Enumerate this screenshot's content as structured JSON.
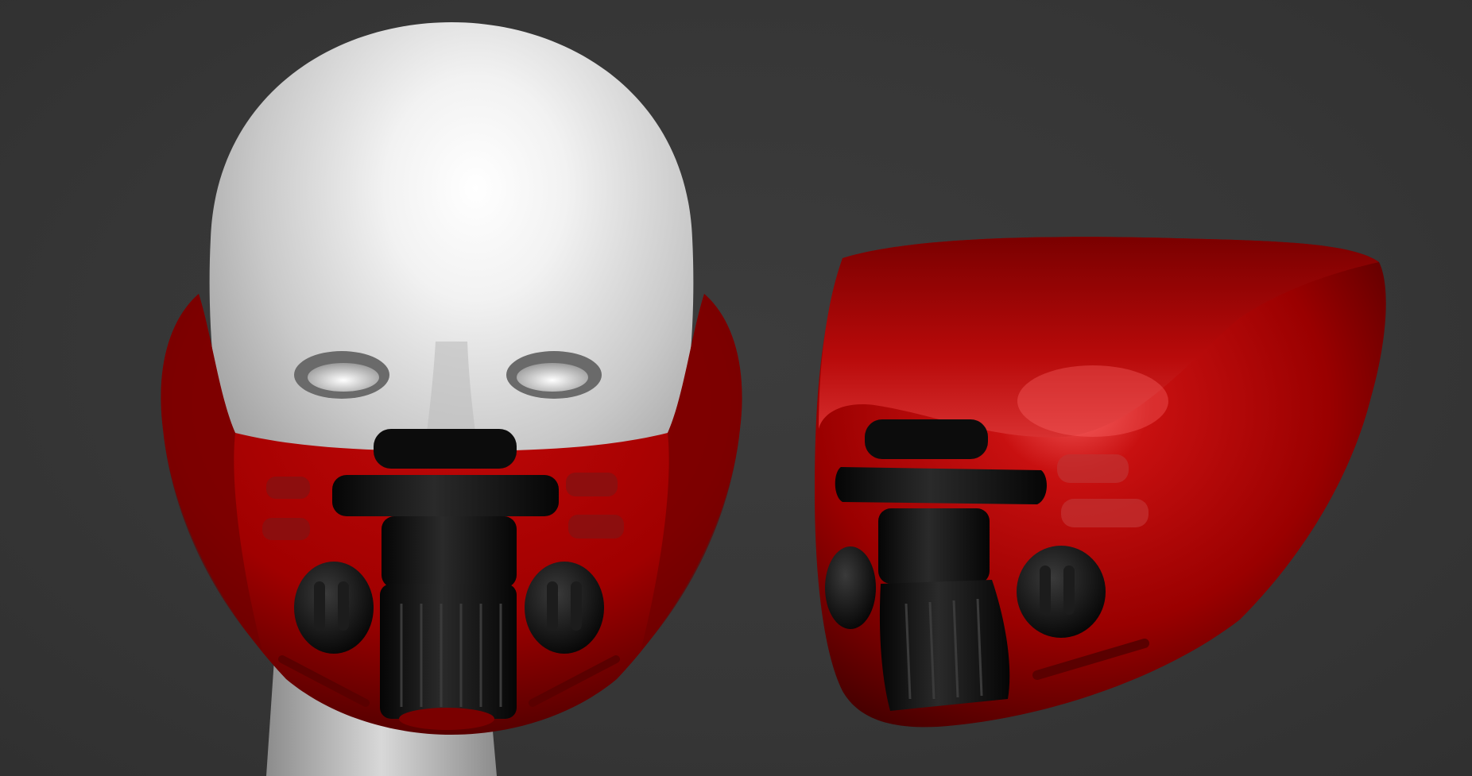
{
  "scene": {
    "background_color": "#383838",
    "mask_color": "#b00000",
    "head_color": "#e8e8e8",
    "filter_color": "#111111",
    "views": [
      {
        "name": "front",
        "subjects": [
          "head-model",
          "respirator-mask"
        ]
      },
      {
        "name": "three-quarter",
        "subjects": [
          "respirator-mask"
        ]
      }
    ]
  }
}
